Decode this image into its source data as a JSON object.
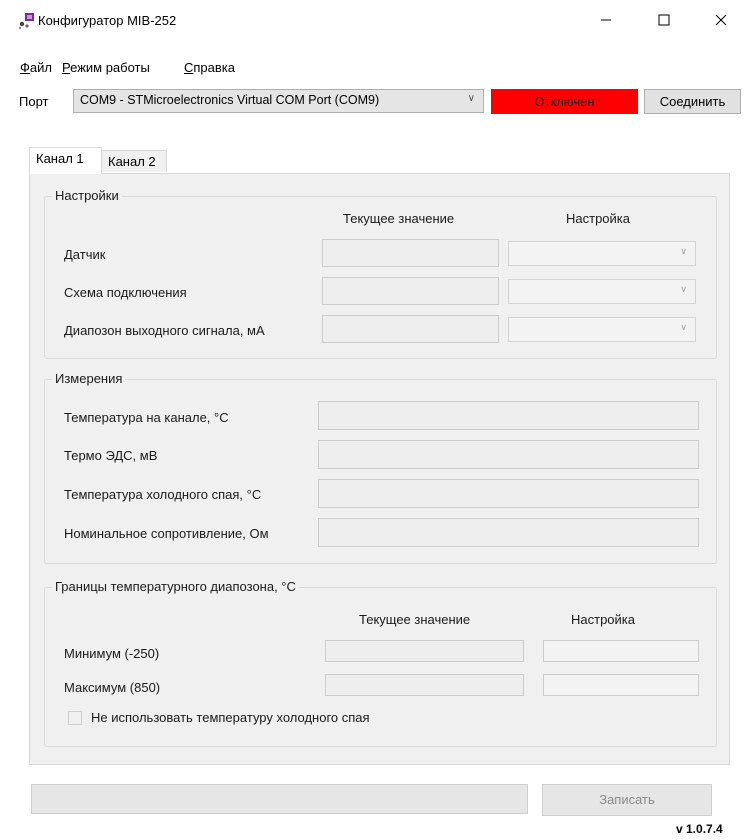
{
  "window": {
    "title": "Конфигуратор MIB-252",
    "minimize": "—",
    "maximize": "☐",
    "close": "✕"
  },
  "menu": {
    "items": [
      {
        "label_u": "Ф",
        "label": "айл"
      },
      {
        "label_u": "Р",
        "label": "ежим работы"
      },
      {
        "label_u": "С",
        "label": "правка"
      }
    ]
  },
  "port": {
    "label": "Порт",
    "selected": "COM9 - STMicroelectronics Virtual COM Port (COM9)",
    "status": "Отключен",
    "status_color": "#ff0000",
    "connect_label": "Соединить"
  },
  "tabs": [
    "Канал 1",
    "Канал 2"
  ],
  "settings": {
    "title": "Настройки",
    "col_current": "Текущее значение",
    "col_setting": "Настройка",
    "rows": [
      "Датчик",
      "Схема подключения",
      "Диапозон выходного сигнала, мА"
    ]
  },
  "measurements": {
    "title": "Измерения",
    "rows": [
      "Температура на канале, °C",
      "Термо ЭДС, мВ",
      "Температура холодного спая, °C",
      "Номинальное сопротивление, Ом"
    ]
  },
  "range": {
    "title": "Границы температурного диапозона, °C",
    "col_current": "Текущее значение",
    "col_setting": "Настройка",
    "rows": [
      "Минимум (-250)",
      "Максимум (850)"
    ],
    "checkbox_label": "Не использовать температуру холодного спая"
  },
  "footer": {
    "write_label": "Записать",
    "version": "v 1.0.7.4"
  }
}
